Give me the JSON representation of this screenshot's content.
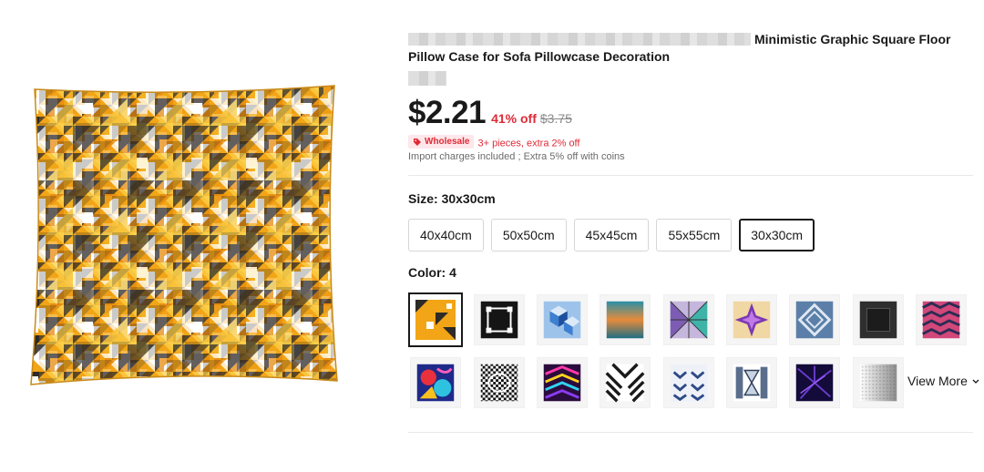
{
  "product": {
    "title_suffix": "Minimistic Graphic Square Floor Pillow Case for Sofa Pillowcase Decoration",
    "price": "$2.21",
    "discount": "41% off",
    "original_price": "$3.75",
    "wholesale_label": "Wholesale",
    "wholesale_text": "3+ pieces, extra 2% off",
    "import_text": "Import charges included ; Extra 5% off with coins"
  },
  "size": {
    "label": "Size: 30x30cm",
    "options": [
      "40x40cm",
      "50x50cm",
      "45x45cm",
      "55x55cm",
      "30x30cm"
    ],
    "selected": "30x30cm"
  },
  "color": {
    "label": "Color: 4",
    "selected_index": 0,
    "swatches": [
      "orange-geometric",
      "black-greek-key",
      "blue-cubes",
      "teal-gradient-waves",
      "purple-triangles",
      "purple-star",
      "blue-diamond",
      "black-square",
      "pink-herringbone",
      "colorful-abstract",
      "black-white-optical",
      "neon-chevron",
      "black-white-stripes",
      "white-blue-arrows",
      "blue-white-bars",
      "dark-purple-rays",
      "white-grey-gradient"
    ],
    "view_more": "View More"
  },
  "colors": {
    "accent": "#e02a37",
    "text": "#191919",
    "muted": "#6b6b6b",
    "border": "#d6d6d6"
  }
}
